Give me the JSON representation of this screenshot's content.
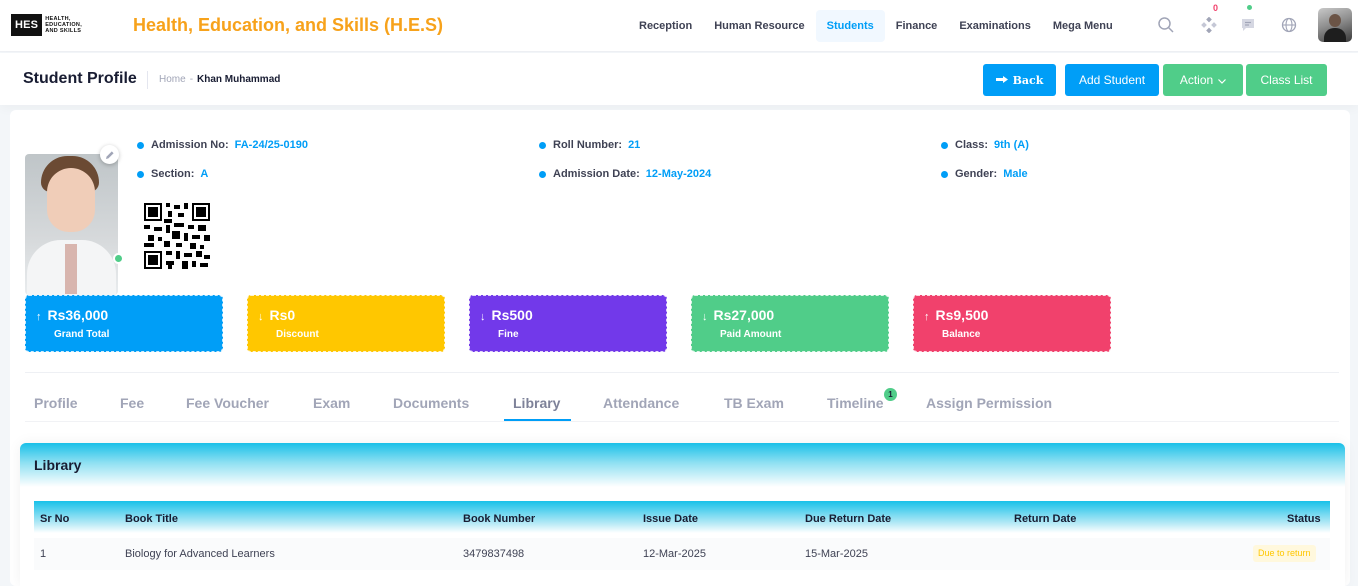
{
  "header": {
    "logo_box": "HES",
    "logo_text": "HEALTH, EDUCATION, AND SKILLS",
    "brand_title": "Health, Education, and Skills (H.E.S)",
    "nav": [
      {
        "label": "Reception",
        "active": false
      },
      {
        "label": "Human Resource",
        "active": false
      },
      {
        "label": "Students",
        "active": true
      },
      {
        "label": "Finance",
        "active": false
      },
      {
        "label": "Examinations",
        "active": false
      },
      {
        "label": "Mega Menu",
        "active": false
      }
    ],
    "notification_count": "0",
    "icons": [
      "search-icon",
      "apps-icon",
      "chat-icon",
      "globe-icon"
    ]
  },
  "toolbar": {
    "page_title": "Student Profile",
    "breadcrumb_home": "Home",
    "breadcrumb_sep": "-",
    "breadcrumb_current": "Khan Muhammad",
    "back_label": "Back",
    "add_student_label": "Add Student",
    "action_label": "Action",
    "class_list_label": "Class List"
  },
  "student": {
    "admission_no_label": "Admission No:",
    "admission_no": "FA-24/25-0190",
    "roll_number_label": "Roll Number:",
    "roll_number": "21",
    "class_label": "Class:",
    "class": "9th (A)",
    "section_label": "Section:",
    "section": "A",
    "admission_date_label": "Admission Date:",
    "admission_date": "12-May-2024",
    "gender_label": "Gender:",
    "gender": "Male"
  },
  "stats": [
    {
      "amount": "Rs36,000",
      "label": "Grand Total",
      "direction": "up",
      "color": "#009ef7"
    },
    {
      "amount": "Rs0",
      "label": "Discount",
      "direction": "down",
      "color": "#ffc700"
    },
    {
      "amount": "Rs500",
      "label": "Fine",
      "direction": "down",
      "color": "#7239ea"
    },
    {
      "amount": "Rs27,000",
      "label": "Paid Amount",
      "direction": "down",
      "color": "#50cd89"
    },
    {
      "amount": "Rs9,500",
      "label": "Balance",
      "direction": "up",
      "color": "#f1416c"
    }
  ],
  "tabs": [
    {
      "label": "Profile"
    },
    {
      "label": "Fee"
    },
    {
      "label": "Fee Voucher"
    },
    {
      "label": "Exam"
    },
    {
      "label": "Documents"
    },
    {
      "label": "Library",
      "active": true
    },
    {
      "label": "Attendance"
    },
    {
      "label": "TB Exam"
    },
    {
      "label": "Timeline",
      "badge": "1"
    },
    {
      "label": "Assign Permission"
    }
  ],
  "library": {
    "title": "Library",
    "columns": [
      "Sr No",
      "Book Title",
      "Book Number",
      "Issue Date",
      "Due Return Date",
      "Return Date",
      "Status"
    ],
    "rows": [
      {
        "sr_no": "1",
        "book_title": "Biology for Advanced Learners",
        "book_number": "3479837498",
        "issue_date": "12-Mar-2025",
        "due_return_date": "15-Mar-2025",
        "return_date": "",
        "status": "Due to return"
      }
    ]
  }
}
